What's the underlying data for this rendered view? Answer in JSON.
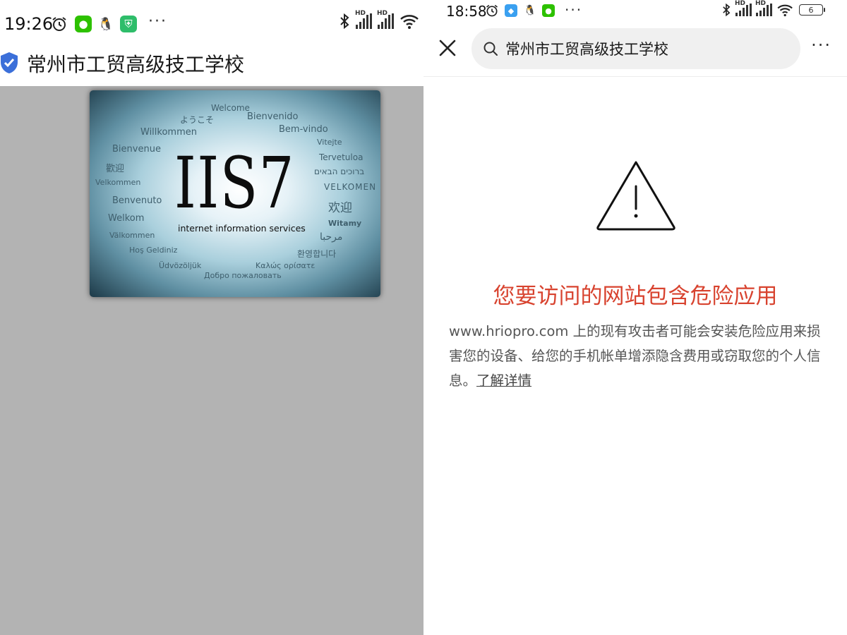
{
  "left": {
    "status_bar": {
      "time": "19:26",
      "more": "···",
      "hd": "HD"
    },
    "header": {
      "title": "常州市工贸高级技工学校"
    },
    "iis_image": {
      "logo_text": "IIS7",
      "subtitle": "internet information services",
      "words": [
        "Welcome",
        "ようこそ",
        "Bienvenido",
        "Willkommen",
        "Bem-vindo",
        "Bienvenue",
        "Vitejte",
        "Tervetuloa",
        "歡迎",
        "ברוכים הבאים",
        "Velkommen",
        "VELKOMEN",
        "Benvenuto",
        "欢迎",
        "Welkom",
        "Witamy",
        "Välkommen",
        "مرحبا",
        "Hoş Geldiniz",
        "환영합니다",
        "Üdvözöljük",
        "Καλώς ορίσατε",
        "Добро пожаловать"
      ]
    }
  },
  "right": {
    "status_bar": {
      "time": "18:58",
      "more": "···",
      "battery": "6",
      "hd": "HD"
    },
    "search": {
      "text": "常州市工贸高级技工学校"
    },
    "more_label": "···",
    "warning": {
      "title": "您要访问的网站包含危险应用",
      "domain": "www.hriopro.com",
      "body": " 上的现有攻击者可能会安装危险应用来损害您的设备、给您的手机帐单增添隐含费用或窃取您的个人信息。",
      "link": "了解详情"
    }
  },
  "colors": {
    "danger_red": "#d8432f",
    "gray_bg": "#b3b3b3",
    "shield_blue": "#3b6fd9",
    "wechat_green": "#2dc100"
  }
}
